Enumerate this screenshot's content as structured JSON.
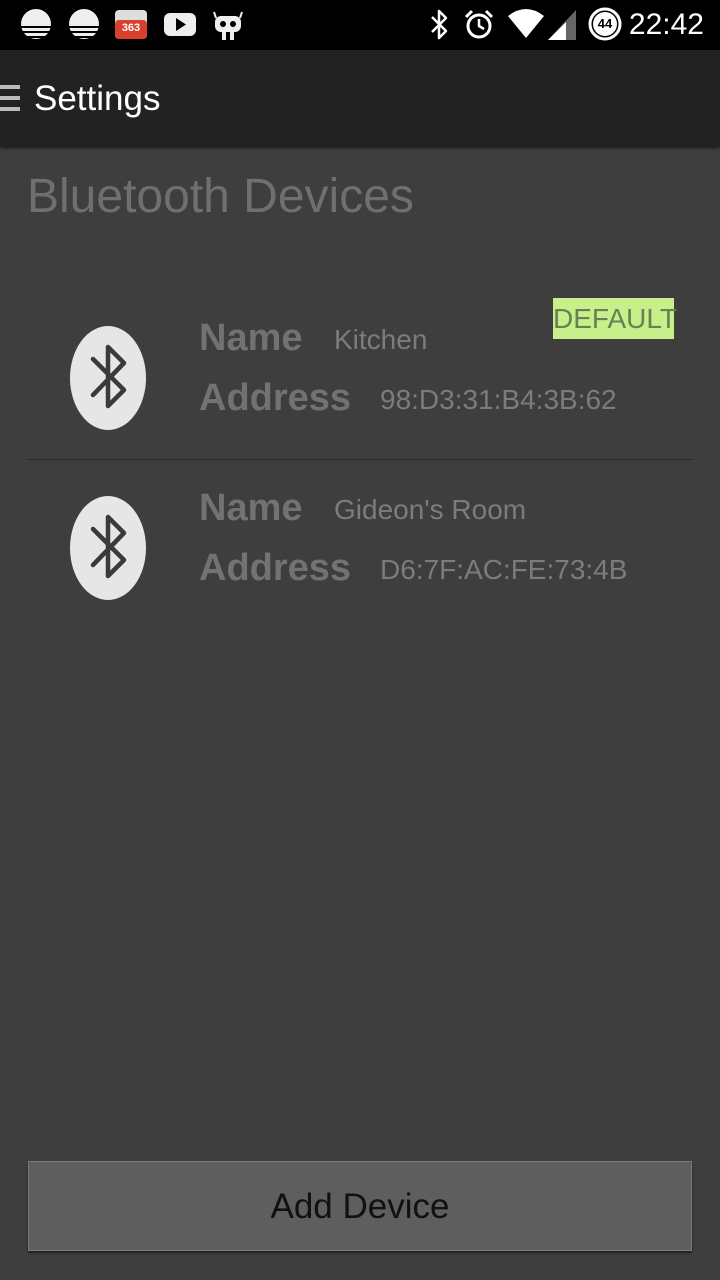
{
  "status_bar": {
    "time": "22:42",
    "battery_level": "44",
    "notification_badge": "363",
    "icons": [
      "weather-icon",
      "weather-icon",
      "calendar-badge-icon",
      "youtube-icon",
      "android-icon",
      "bluetooth-icon",
      "alarm-icon",
      "wifi-icon",
      "signal-icon",
      "battery-icon"
    ]
  },
  "action_bar": {
    "title": "Settings",
    "icon": "menu-icon"
  },
  "page": {
    "title": "Bluetooth Devices"
  },
  "devices": [
    {
      "name_label": "Name",
      "name": "Kitchen",
      "address_label": "Address",
      "address": "98:D3:31:B4:3B:62",
      "badge": "DEFAULT",
      "icon": "bluetooth-icon"
    },
    {
      "name_label": "Name",
      "name": "Gideon's Room",
      "address_label": "Address",
      "address": "D6:7F:AC:FE:73:4B",
      "icon": "bluetooth-icon"
    }
  ],
  "footer": {
    "add_button_label": "Add Device"
  },
  "colors": {
    "background": "#3e3e3e",
    "action_bar": "#222222",
    "default_badge": "#c8f08a",
    "button": "#5e5e5e"
  }
}
